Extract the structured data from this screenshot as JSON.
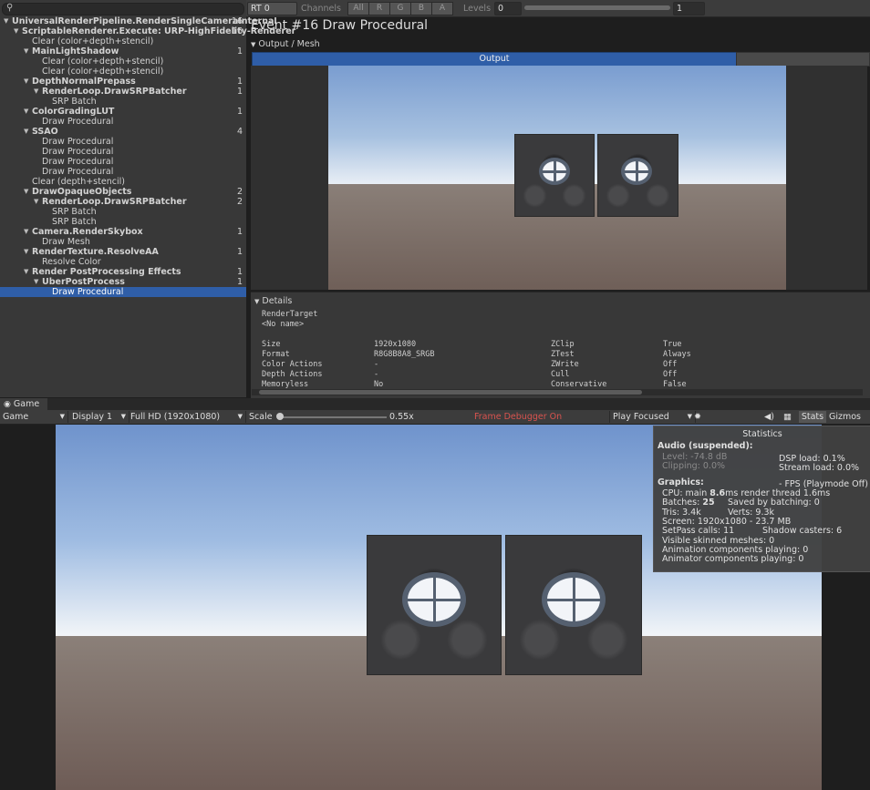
{
  "tree": {
    "search_placeholder": "",
    "rows": [
      {
        "label": "UniversalRenderPipeline.RenderSingleCameraInternal",
        "count": "16",
        "bold": true,
        "arrow": true
      },
      {
        "label": "ScriptableRenderer.Execute: URP-HighFidelity-Renderer",
        "count": "16",
        "bold": true,
        "arrow": true
      },
      {
        "label": "Clear (color+depth+stencil)",
        "count": "",
        "bold": false,
        "arrow": false
      },
      {
        "label": "MainLightShadow",
        "count": "1",
        "bold": true,
        "arrow": true
      },
      {
        "label": "Clear (color+depth+stencil)",
        "count": "",
        "bold": false,
        "arrow": false
      },
      {
        "label": "Clear (color+depth+stencil)",
        "count": "",
        "bold": false,
        "arrow": false
      },
      {
        "label": "DepthNormalPrepass",
        "count": "1",
        "bold": true,
        "arrow": true
      },
      {
        "label": "RenderLoop.DrawSRPBatcher",
        "count": "1",
        "bold": true,
        "arrow": true
      },
      {
        "label": "SRP Batch",
        "count": "",
        "bold": false,
        "arrow": false
      },
      {
        "label": "ColorGradingLUT",
        "count": "1",
        "bold": true,
        "arrow": true
      },
      {
        "label": "Draw Procedural",
        "count": "",
        "bold": false,
        "arrow": false
      },
      {
        "label": "SSAO",
        "count": "4",
        "bold": true,
        "arrow": true
      },
      {
        "label": "Draw Procedural",
        "count": "",
        "bold": false,
        "arrow": false
      },
      {
        "label": "Draw Procedural",
        "count": "",
        "bold": false,
        "arrow": false
      },
      {
        "label": "Draw Procedural",
        "count": "",
        "bold": false,
        "arrow": false
      },
      {
        "label": "Draw Procedural",
        "count": "",
        "bold": false,
        "arrow": false
      },
      {
        "label": "Clear (depth+stencil)",
        "count": "",
        "bold": false,
        "arrow": false
      },
      {
        "label": "DrawOpaqueObjects",
        "count": "2",
        "bold": true,
        "arrow": true
      },
      {
        "label": "RenderLoop.DrawSRPBatcher",
        "count": "2",
        "bold": true,
        "arrow": true
      },
      {
        "label": "SRP Batch",
        "count": "",
        "bold": false,
        "arrow": false
      },
      {
        "label": "SRP Batch",
        "count": "",
        "bold": false,
        "arrow": false
      },
      {
        "label": "Camera.RenderSkybox",
        "count": "1",
        "bold": true,
        "arrow": true
      },
      {
        "label": "Draw Mesh",
        "count": "",
        "bold": false,
        "arrow": false
      },
      {
        "label": "RenderTexture.ResolveAA",
        "count": "1",
        "bold": true,
        "arrow": true
      },
      {
        "label": "Resolve Color",
        "count": "",
        "bold": false,
        "arrow": false
      },
      {
        "label": "Render PostProcessing Effects",
        "count": "1",
        "bold": true,
        "arrow": true
      },
      {
        "label": "UberPostProcess",
        "count": "1",
        "bold": true,
        "arrow": true
      },
      {
        "label": "Draw Procedural",
        "count": "",
        "bold": false,
        "arrow": false
      }
    ]
  },
  "toolbar": {
    "rt": "RT 0",
    "channels_label": "Channels",
    "channels": [
      "All",
      "R",
      "G",
      "B",
      "A"
    ],
    "levels_label": "Levels",
    "levels_min": "0",
    "levels_max": "1"
  },
  "event": {
    "title": "Event #16 Draw Procedural"
  },
  "output": {
    "header": "Output / Mesh",
    "tab": "Output"
  },
  "details": {
    "header": "Details",
    "render_target_label": "RenderTarget",
    "render_target_value": "<No name>",
    "left": [
      {
        "k": "Size",
        "v": "1920x1080"
      },
      {
        "k": "Format",
        "v": "R8G8B8A8_SRGB"
      },
      {
        "k": "Color Actions",
        "v": "-"
      },
      {
        "k": "Depth Actions",
        "v": "-"
      },
      {
        "k": "Memoryless",
        "v": "No"
      }
    ],
    "right": [
      {
        "k": "ZClip",
        "v": "True"
      },
      {
        "k": "ZTest",
        "v": "Always"
      },
      {
        "k": "ZWrite",
        "v": "Off"
      },
      {
        "k": "Cull",
        "v": "Off"
      },
      {
        "k": "Conservative",
        "v": "False"
      }
    ]
  },
  "game": {
    "tab": "Game",
    "mode": "Game",
    "display": "Display 1",
    "resolution": "Full HD (1920x1080)",
    "scale_label": "Scale",
    "scale_value": "0.55x",
    "scale_fraction": 0.0,
    "frame_debugger": "Frame Debugger On",
    "play_focus": "Play Focused",
    "stats": "Stats",
    "gizmos": "Gizmos"
  },
  "stats": {
    "title": "Statistics",
    "audio_header": "Audio (suspended):",
    "level": "Level: -74.8 dB",
    "clipping": "Clipping: 0.0%",
    "dsp": "DSP load: 0.1%",
    "stream": "Stream load: 0.0%",
    "graphics_header": "Graphics:",
    "fps": "- FPS (Playmode Off)",
    "cpu_prefix": "CPU: main ",
    "cpu_main": "8.6",
    "cpu_suffix": "ms  render thread 1.6ms",
    "batches_prefix": "Batches: ",
    "batches": "25",
    "saved": "Saved by batching: 0",
    "tris": "Tris: 3.4k",
    "verts": "Verts: 9.3k",
    "screen": "Screen: 1920x1080 - 23.7 MB",
    "setpass": "SetPass calls: 11",
    "shadow": "Shadow casters: 6",
    "skinned": "Visible skinned meshes: 0",
    "anim": "Animation components playing: 0",
    "animator": "Animator components playing: 0"
  },
  "colors": {
    "selection": "#2f5ea8",
    "frame_debugger": "#d9534f",
    "panel": "#383838"
  }
}
